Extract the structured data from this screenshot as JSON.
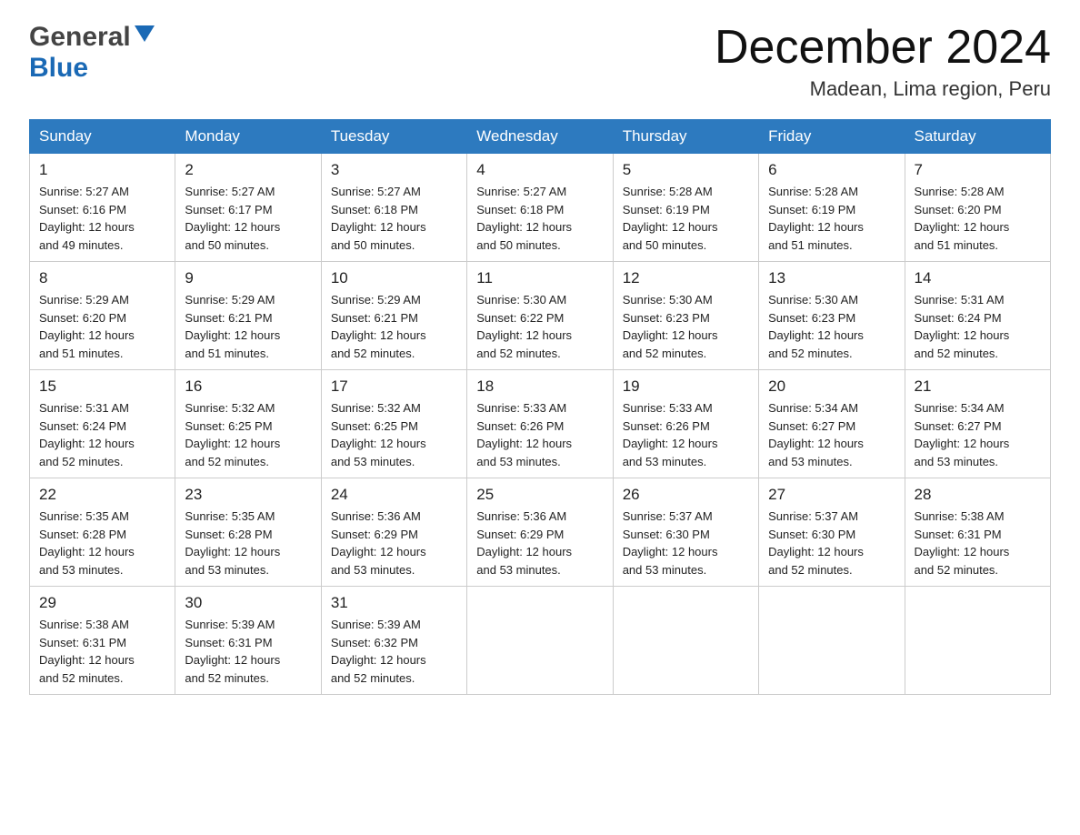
{
  "header": {
    "logo_general": "General",
    "logo_blue": "Blue",
    "title": "December 2024",
    "location": "Madean, Lima region, Peru"
  },
  "days_of_week": [
    "Sunday",
    "Monday",
    "Tuesday",
    "Wednesday",
    "Thursday",
    "Friday",
    "Saturday"
  ],
  "weeks": [
    [
      {
        "day": "1",
        "sunrise": "5:27 AM",
        "sunset": "6:16 PM",
        "daylight": "12 hours and 49 minutes."
      },
      {
        "day": "2",
        "sunrise": "5:27 AM",
        "sunset": "6:17 PM",
        "daylight": "12 hours and 50 minutes."
      },
      {
        "day": "3",
        "sunrise": "5:27 AM",
        "sunset": "6:18 PM",
        "daylight": "12 hours and 50 minutes."
      },
      {
        "day": "4",
        "sunrise": "5:27 AM",
        "sunset": "6:18 PM",
        "daylight": "12 hours and 50 minutes."
      },
      {
        "day": "5",
        "sunrise": "5:28 AM",
        "sunset": "6:19 PM",
        "daylight": "12 hours and 50 minutes."
      },
      {
        "day": "6",
        "sunrise": "5:28 AM",
        "sunset": "6:19 PM",
        "daylight": "12 hours and 51 minutes."
      },
      {
        "day": "7",
        "sunrise": "5:28 AM",
        "sunset": "6:20 PM",
        "daylight": "12 hours and 51 minutes."
      }
    ],
    [
      {
        "day": "8",
        "sunrise": "5:29 AM",
        "sunset": "6:20 PM",
        "daylight": "12 hours and 51 minutes."
      },
      {
        "day": "9",
        "sunrise": "5:29 AM",
        "sunset": "6:21 PM",
        "daylight": "12 hours and 51 minutes."
      },
      {
        "day": "10",
        "sunrise": "5:29 AM",
        "sunset": "6:21 PM",
        "daylight": "12 hours and 52 minutes."
      },
      {
        "day": "11",
        "sunrise": "5:30 AM",
        "sunset": "6:22 PM",
        "daylight": "12 hours and 52 minutes."
      },
      {
        "day": "12",
        "sunrise": "5:30 AM",
        "sunset": "6:23 PM",
        "daylight": "12 hours and 52 minutes."
      },
      {
        "day": "13",
        "sunrise": "5:30 AM",
        "sunset": "6:23 PM",
        "daylight": "12 hours and 52 minutes."
      },
      {
        "day": "14",
        "sunrise": "5:31 AM",
        "sunset": "6:24 PM",
        "daylight": "12 hours and 52 minutes."
      }
    ],
    [
      {
        "day": "15",
        "sunrise": "5:31 AM",
        "sunset": "6:24 PM",
        "daylight": "12 hours and 52 minutes."
      },
      {
        "day": "16",
        "sunrise": "5:32 AM",
        "sunset": "6:25 PM",
        "daylight": "12 hours and 52 minutes."
      },
      {
        "day": "17",
        "sunrise": "5:32 AM",
        "sunset": "6:25 PM",
        "daylight": "12 hours and 53 minutes."
      },
      {
        "day": "18",
        "sunrise": "5:33 AM",
        "sunset": "6:26 PM",
        "daylight": "12 hours and 53 minutes."
      },
      {
        "day": "19",
        "sunrise": "5:33 AM",
        "sunset": "6:26 PM",
        "daylight": "12 hours and 53 minutes."
      },
      {
        "day": "20",
        "sunrise": "5:34 AM",
        "sunset": "6:27 PM",
        "daylight": "12 hours and 53 minutes."
      },
      {
        "day": "21",
        "sunrise": "5:34 AM",
        "sunset": "6:27 PM",
        "daylight": "12 hours and 53 minutes."
      }
    ],
    [
      {
        "day": "22",
        "sunrise": "5:35 AM",
        "sunset": "6:28 PM",
        "daylight": "12 hours and 53 minutes."
      },
      {
        "day": "23",
        "sunrise": "5:35 AM",
        "sunset": "6:28 PM",
        "daylight": "12 hours and 53 minutes."
      },
      {
        "day": "24",
        "sunrise": "5:36 AM",
        "sunset": "6:29 PM",
        "daylight": "12 hours and 53 minutes."
      },
      {
        "day": "25",
        "sunrise": "5:36 AM",
        "sunset": "6:29 PM",
        "daylight": "12 hours and 53 minutes."
      },
      {
        "day": "26",
        "sunrise": "5:37 AM",
        "sunset": "6:30 PM",
        "daylight": "12 hours and 53 minutes."
      },
      {
        "day": "27",
        "sunrise": "5:37 AM",
        "sunset": "6:30 PM",
        "daylight": "12 hours and 52 minutes."
      },
      {
        "day": "28",
        "sunrise": "5:38 AM",
        "sunset": "6:31 PM",
        "daylight": "12 hours and 52 minutes."
      }
    ],
    [
      {
        "day": "29",
        "sunrise": "5:38 AM",
        "sunset": "6:31 PM",
        "daylight": "12 hours and 52 minutes."
      },
      {
        "day": "30",
        "sunrise": "5:39 AM",
        "sunset": "6:31 PM",
        "daylight": "12 hours and 52 minutes."
      },
      {
        "day": "31",
        "sunrise": "5:39 AM",
        "sunset": "6:32 PM",
        "daylight": "12 hours and 52 minutes."
      },
      null,
      null,
      null,
      null
    ]
  ],
  "labels": {
    "sunrise": "Sunrise:",
    "sunset": "Sunset:",
    "daylight": "Daylight:"
  }
}
